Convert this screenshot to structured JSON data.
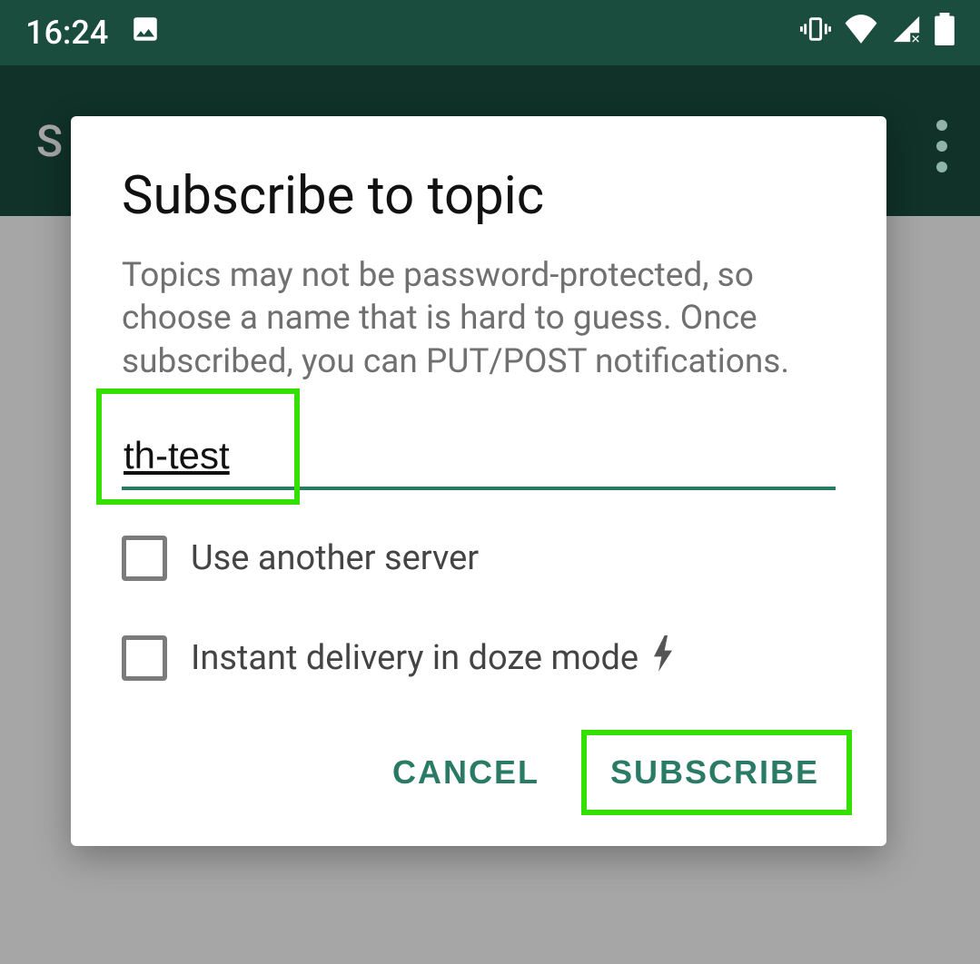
{
  "statusbar": {
    "time": "16:24"
  },
  "appbar": {
    "title_initial": "S"
  },
  "dialog": {
    "title": "Subscribe to topic",
    "description": "Topics may not be password-protected, so choose a name that is hard to guess. Once subscribed, you can PUT/POST notifications.",
    "topic_value": "th-test",
    "option_another_server": "Use another server",
    "option_instant_delivery": "Instant delivery in doze mode",
    "cancel_label": "CANCEL",
    "subscribe_label": "SUBSCRIBE"
  }
}
